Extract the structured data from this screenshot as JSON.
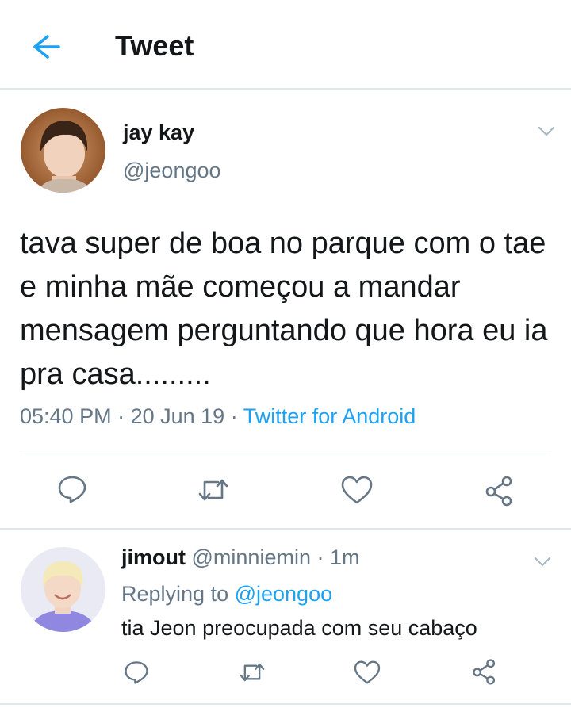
{
  "header": {
    "title": "Tweet",
    "back_icon": "arrow-left-icon"
  },
  "colors": {
    "accent": "#1da1f2",
    "text": "#14171a",
    "muted": "#657786",
    "divider": "#e1e8ed"
  },
  "tweet": {
    "name": "jay kay",
    "handle": "@jeongoo",
    "text": "tava super de boa no parque com o tae e minha mãe começou a mandar mensagem perguntando que hora eu ia pra casa.........",
    "time": "05:40 PM",
    "sep1": " · ",
    "date": "20 Jun 19",
    "sep2": " · ",
    "source": "Twitter for Android",
    "actions": [
      "reply-icon",
      "retweet-icon",
      "like-icon",
      "share-icon"
    ]
  },
  "reply": {
    "name": "jimout",
    "handle": "@minniemin",
    "sep": " · ",
    "time": "1m",
    "replying_prefix": "Replying to ",
    "replying_handle": "@jeongoo",
    "text": "tia Jeon preocupada com seu cabaço",
    "actions": [
      "reply-icon",
      "retweet-icon",
      "like-icon",
      "share-icon"
    ]
  }
}
